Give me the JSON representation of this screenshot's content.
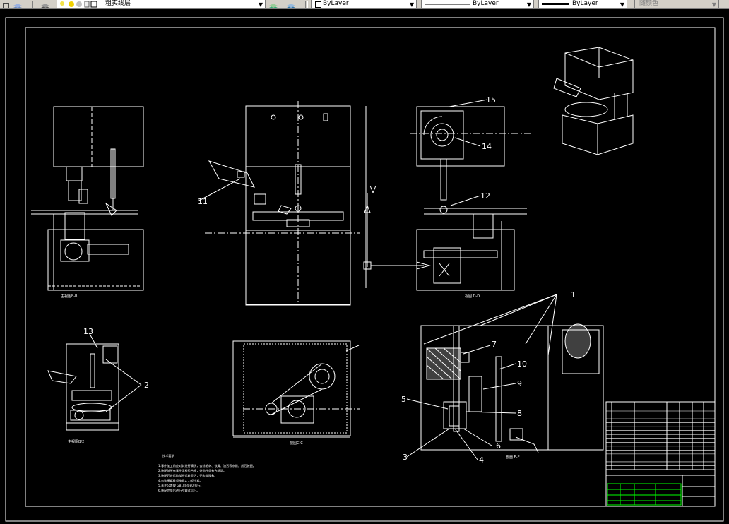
{
  "toolbar": {
    "layer_combo": {
      "value": "粗实线层",
      "icons": [
        "sun-icon",
        "lock-icon",
        "color-square-icon"
      ]
    },
    "color_combo": {
      "value": "ByLayer"
    },
    "linetype_combo": {
      "value": "ByLayer"
    },
    "lineweight_combo": {
      "value": "ByLayer"
    },
    "plotstyle_combo": {
      "value": "随颜色"
    }
  },
  "drawing": {
    "background": "#000000",
    "line_color": "#ffffff",
    "accent_green": "#00ff00",
    "callouts": [
      "1",
      "2",
      "3",
      "4",
      "5",
      "6",
      "7",
      "8",
      "9",
      "10",
      "11",
      "12",
      "13",
      "14",
      "15"
    ],
    "view_labels": {
      "left_view": "主视图B-B",
      "bottom_left": "主视图B/2",
      "center_plan": "视图C-C",
      "right_section": "剖面 E-E",
      "right_front": "视图 D-D"
    },
    "tech_requirements_title": "技术要求",
    "tech_requirements": [
      "1.零件加工前应对其进行清洗，去除毛刺、铁屑、油污等杂质，然后装配。",
      "2.装配前所有零件须检验合格，外购件须有合格证。",
      "3.装配后各运动部件运转灵活，无卡滞现象。",
      "4.各连接螺栓须按规定力矩拧紧。",
      "5.未注公差按 GB1804-80 执行。",
      "6.装配完毕后进行空载试运行。"
    ],
    "title_block_rows": 15
  }
}
